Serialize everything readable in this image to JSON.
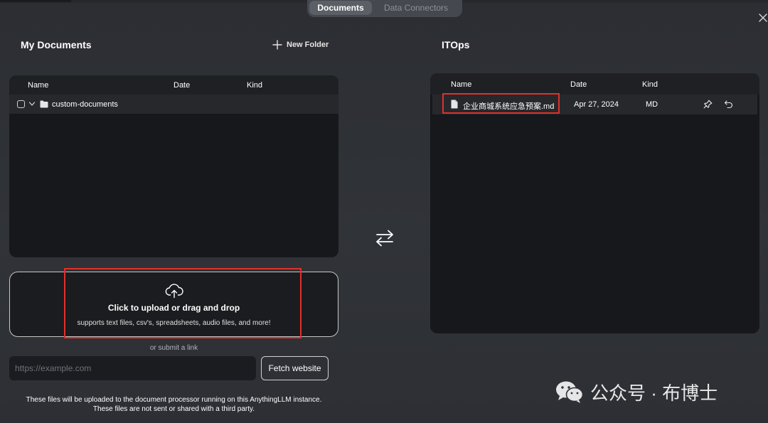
{
  "tabs": [
    {
      "label": "Documents",
      "active": true
    },
    {
      "label": "Data Connectors",
      "active": false
    }
  ],
  "my_documents": {
    "title": "My Documents",
    "new_folder_label": "New Folder",
    "columns": {
      "name": "Name",
      "date": "Date",
      "kind": "Kind"
    },
    "rows": [
      {
        "name": "custom-documents",
        "type": "folder",
        "checked": false
      }
    ]
  },
  "upload": {
    "title": "Click to upload or drag and drop",
    "subtitle": "supports text files, csv's, spreadsheets, audio files, and more!",
    "or_link": "or submit a link",
    "url_placeholder": "https://example.com",
    "fetch_label": "Fetch website",
    "footnote_line1": "These files will be uploaded to the document processor running on this AnythingLLM instance.",
    "footnote_line2": "These files are not sent or shared with a third party."
  },
  "workspace": {
    "title": "ITOps",
    "columns": {
      "name": "Name",
      "date": "Date",
      "kind": "Kind"
    },
    "rows": [
      {
        "name": "企业商城系统应急预案.md",
        "date": "Apr 27, 2024",
        "kind": "MD"
      }
    ]
  },
  "watermark": {
    "text": "公众号 · 布博士"
  },
  "icons": {
    "close": "close-icon",
    "plus": "plus-icon",
    "swap": "swap-arrows-icon",
    "upload": "cloud-upload-icon",
    "pin": "pin-icon",
    "undo": "undo-icon"
  },
  "colors": {
    "background": "#2f3136",
    "panel": "#17181b",
    "highlight": "#e0302a",
    "text": "#ffffff"
  }
}
